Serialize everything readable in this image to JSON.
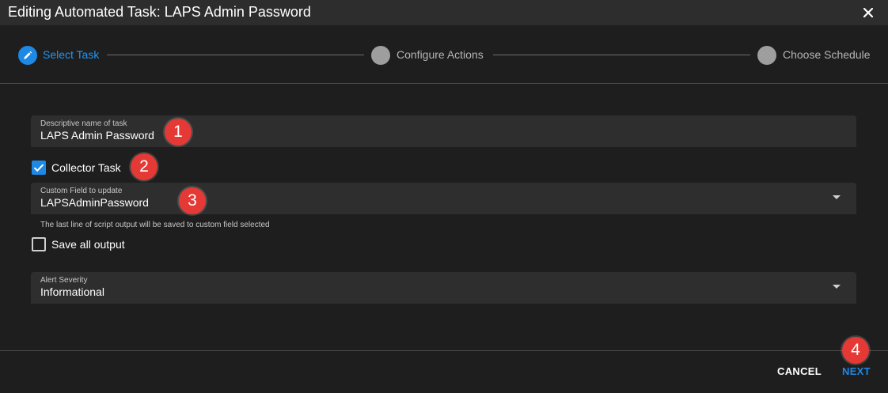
{
  "dialog": {
    "title": "Editing Automated Task: LAPS Admin Password"
  },
  "stepper": {
    "steps": [
      {
        "label": "Select Task",
        "state": "active"
      },
      {
        "label": "Configure Actions",
        "state": "inactive"
      },
      {
        "label": "Choose Schedule",
        "state": "inactive"
      }
    ]
  },
  "form": {
    "task_name": {
      "label": "Descriptive name of task",
      "value": "LAPS Admin Password"
    },
    "collector_task": {
      "label": "Collector Task",
      "checked": true
    },
    "custom_field": {
      "label": "Custom Field to update",
      "value": "LAPSAdminPassword",
      "hint": "The last line of script output will be saved to custom field selected"
    },
    "save_all_output": {
      "label": "Save all output",
      "checked": false
    },
    "alert_severity": {
      "label": "Alert Severity",
      "value": "Informational"
    }
  },
  "annotations": [
    "1",
    "2",
    "3",
    "4"
  ],
  "footer": {
    "cancel_label": "CANCEL",
    "next_label": "NEXT"
  },
  "colors": {
    "accent": "#1e88e5",
    "badge": "#e53935",
    "background": "#1e1e1e",
    "field_bg": "#2e2e2e",
    "inactive_step": "#8f8f8f"
  },
  "icons": {
    "close": "close-icon",
    "step_edit": "pencil-icon",
    "checked": "checkmark-icon",
    "dropdown": "chevron-down-icon"
  }
}
